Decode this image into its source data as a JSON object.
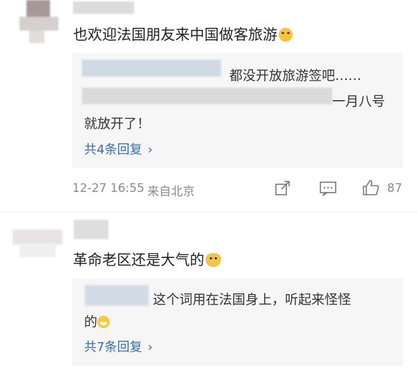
{
  "comments": [
    {
      "text": "也欢迎法国朋友来中国做客旅游",
      "emoji_icon": "crying-face-icon",
      "replies": [
        {
          "text": "都没开放旅游签吧……"
        },
        {
          "text": "一月八号"
        },
        {
          "text": "就放开了！"
        }
      ],
      "reply_link": "共4条回复",
      "timestamp": "12-27 16:55",
      "location": "来自北京",
      "like_count": "87"
    },
    {
      "text": "革命老区还是大气的",
      "emoji_icon": "doge-icon",
      "replies": [
        {
          "text": "这个词用在法国身上，听起来怪怪"
        },
        {
          "text": "的"
        }
      ],
      "reply_link": "共7条回复"
    }
  ],
  "colors": {
    "link": "#3d6da3",
    "meta": "#8a8a8a",
    "reply_bg": "#f6f6f6"
  }
}
